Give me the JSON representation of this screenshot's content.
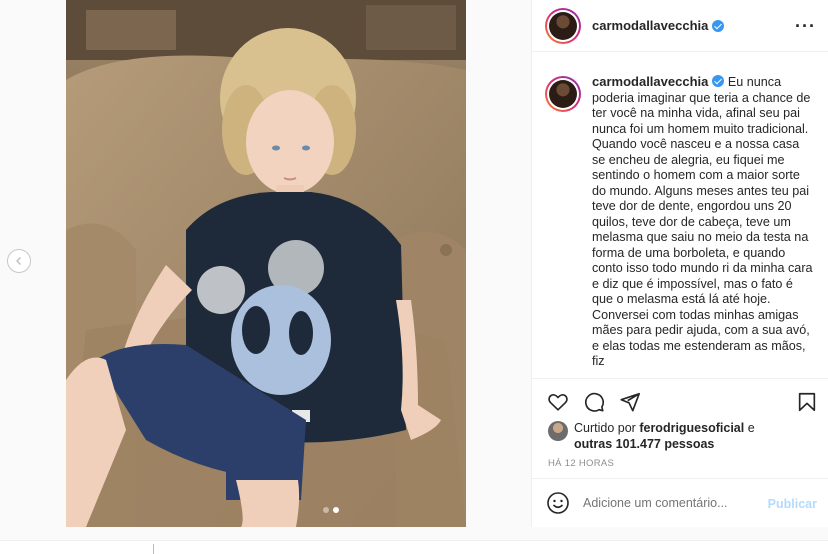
{
  "post": {
    "username": "carmodallavecchia",
    "caption": "Eu nunca poderia imaginar que teria a chance de ter você na minha vida, afinal seu pai nunca foi um homem muito tradicional. Quando você nasceu e a nossa casa se encheu de alegria, eu fiquei me sentindo o homem com a maior sorte do mundo. Alguns meses antes teu pai teve dor de dente, engordou uns 20 quilos, teve dor de cabeça, teve um melasma que saiu no meio da testa na forma de uma borboleta, e quando conto isso todo mundo ri da minha cara e diz que é impossível, mas o fato é que o melasma está lá até hoje. Conversei com todas minhas amigas mães para pedir ajuda, com a sua avó, e elas todas me estenderam as mãos, fiz",
    "liked_by_prefix": "Curtido por",
    "liked_by_user": "ferodriguesoficial",
    "liked_by_and": "e",
    "likes_others": "outras 101.477 pessoas",
    "time_ago": "HÁ 12 HORAS",
    "carousel": {
      "total": 2,
      "current": 2
    }
  },
  "comment": {
    "placeholder": "Adicione um comentário...",
    "publish_label": "Publicar"
  },
  "icons": {
    "more": "more-options-icon",
    "like": "heart-icon",
    "comment": "comment-icon",
    "share": "paper-plane-icon",
    "save": "bookmark-icon",
    "emoji": "emoji-icon",
    "prev": "chevron-left-icon"
  },
  "colors": {
    "accent": "#3897f0",
    "publish_disabled": "#b3dbff",
    "muted": "#8e8e8e"
  }
}
